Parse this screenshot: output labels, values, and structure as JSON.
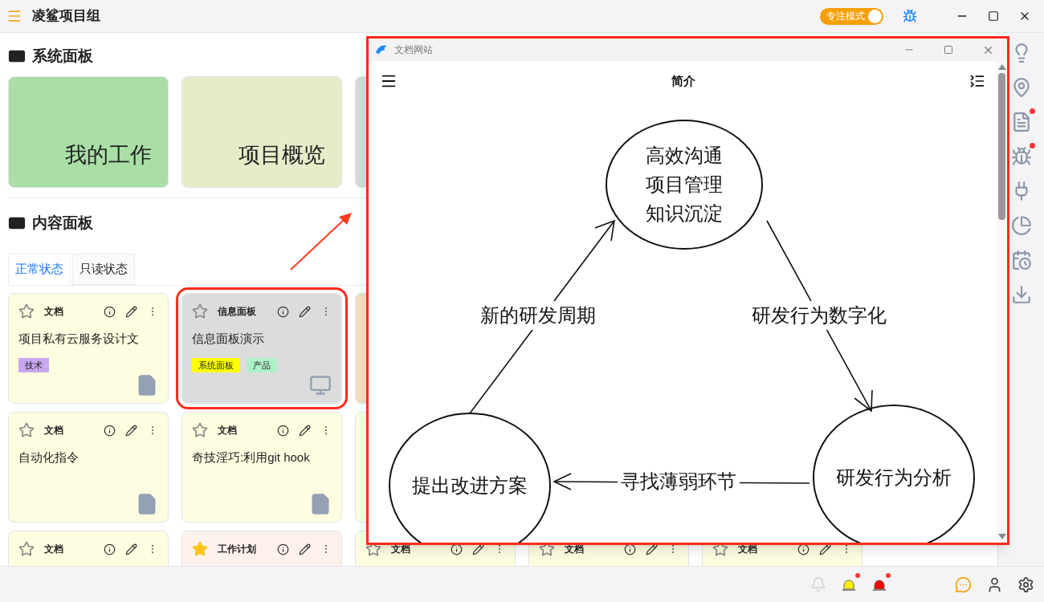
{
  "app": {
    "title": "凌鲨项目组",
    "focus_mode": {
      "label": "专注模式",
      "on": true
    }
  },
  "system_panel": {
    "heading": "系统面板",
    "cards": [
      {
        "title": "我的工作",
        "color": "#a9dfa6"
      },
      {
        "title": "项目概览",
        "color": "#e6ecc9"
      },
      {
        "color": "#d9d9d9"
      }
    ]
  },
  "content_panel": {
    "heading": "内容面板",
    "tabs": [
      {
        "label": "正常状态",
        "selected": true
      },
      {
        "label": "只读状态",
        "selected": false
      }
    ],
    "rows": [
      [
        {
          "kind": "doc",
          "category": "文档",
          "starred": false,
          "title": "项目私有云服务设计文",
          "tags": [
            {
              "label": "技术",
              "color": "#c9a8f0"
            }
          ],
          "highlighted": false
        },
        {
          "kind": "panel",
          "category": "信息面板",
          "starred": false,
          "title": "信息面板演示",
          "tags": [
            {
              "label": "系统面板",
              "color": "#ffff00"
            },
            {
              "label": "产品",
              "color": "#aef0c8"
            }
          ],
          "highlighted": true
        },
        {
          "kind": "task"
        }
      ],
      [
        {
          "kind": "doc",
          "category": "文档",
          "starred": false,
          "title": "自动化指令",
          "highlighted": false
        },
        {
          "kind": "doc",
          "category": "文档",
          "starred": false,
          "title": "奇技淫巧:利用git hook",
          "highlighted": false
        },
        {
          "kind": "doc"
        }
      ],
      [
        {
          "kind": "doc",
          "category": "文档",
          "starred": false
        },
        {
          "kind": "plan",
          "category": "工作计划",
          "starred": true
        },
        {
          "kind": "doc",
          "category": "文档",
          "starred": false
        },
        {
          "kind": "doc",
          "category": "文档",
          "starred": false
        },
        {
          "kind": "doc",
          "category": "文档",
          "starred": false
        }
      ]
    ]
  },
  "sidebar": {
    "items": [
      {
        "badge": false
      },
      {
        "badge": false
      },
      {
        "badge": true
      },
      {
        "badge": true
      },
      {
        "badge": false
      },
      {
        "badge": false
      },
      {
        "badge": false
      },
      {
        "badge": false
      }
    ]
  },
  "status_bar": {
    "alerts": [
      {
        "color": "#d4d4d4",
        "badge": false
      },
      {
        "color": "#ffee00",
        "badge": true
      },
      {
        "color": "#ff0000",
        "badge": true
      }
    ]
  },
  "doc_window": {
    "title": "文档网站",
    "page_title": "简介",
    "diagram": {
      "nodes": [
        {
          "lines": [
            "高效沟通",
            "项目管理",
            "知识沉淀"
          ]
        },
        {
          "lines": [
            "提出改进方案"
          ]
        },
        {
          "lines": [
            "研发行为分析"
          ]
        }
      ],
      "edges": [
        {
          "label": "新的研发周期"
        },
        {
          "label": "研发行为数字化"
        },
        {
          "label": "寻找薄弱环节"
        }
      ]
    }
  }
}
